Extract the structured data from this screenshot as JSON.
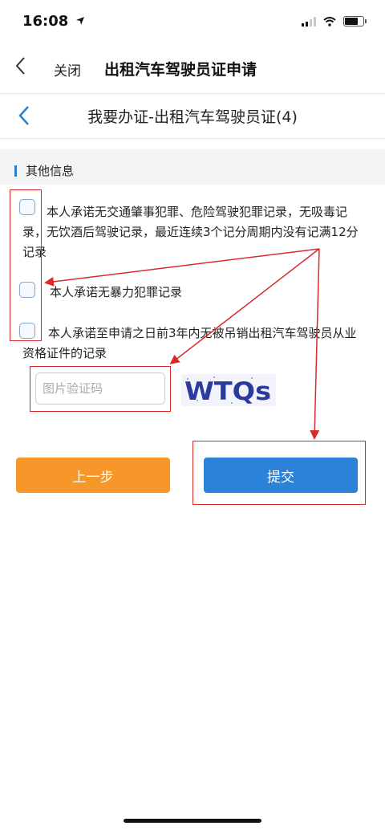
{
  "status_bar": {
    "time": "16:08"
  },
  "nav": {
    "close_label": "关闭",
    "title": "出租汽车驾驶员证申请"
  },
  "page": {
    "title": "我要办证-出租汽车驾驶员证(4)"
  },
  "section": {
    "title": "其他信息"
  },
  "items": [
    {
      "text": "本人承诺无交通肇事犯罪、危险驾驶犯罪记录，无吸毒记录，无饮酒后驾驶记录，最近连续3个记分周期内没有记满12分记录",
      "checked": false
    },
    {
      "text": "本人承诺无暴力犯罪记录",
      "checked": false
    },
    {
      "text": "本人承诺至申请之日前3年内无被吊销出租汽车驾驶员从业资格证件的记录",
      "checked": false
    }
  ],
  "captcha": {
    "placeholder": "图片验证码",
    "value": "",
    "image_text": "WTQs"
  },
  "buttons": {
    "prev_label": "上一步",
    "submit_label": "提交"
  },
  "colors": {
    "accent": "#2a83d8",
    "prev_button": "#f7972a",
    "annotation": "#d72b2b"
  },
  "icons": [
    "location-arrow-icon",
    "signal-icon",
    "wifi-icon",
    "battery-icon",
    "back-chevron-icon",
    "checkbox-icon"
  ]
}
